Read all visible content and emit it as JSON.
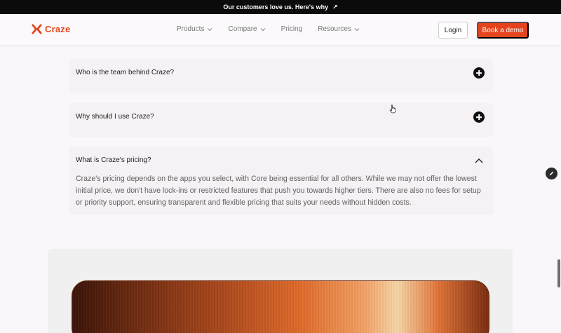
{
  "announcement": {
    "text": "Our customers love us. Here's why",
    "arrow": "↗"
  },
  "brand": {
    "name": "Craze",
    "color": "#e4441d",
    "icon": "craze-x-logo-icon"
  },
  "nav": {
    "items": [
      {
        "label": "Products",
        "has_dropdown": true
      },
      {
        "label": "Compare",
        "has_dropdown": true
      },
      {
        "label": "Pricing",
        "has_dropdown": false
      },
      {
        "label": "Resources",
        "has_dropdown": true
      }
    ],
    "login_label": "Login",
    "demo_label": "Book a demo"
  },
  "faq": [
    {
      "question": "Who is the team behind Craze?",
      "expanded": false,
      "icon": "plus-circle-icon"
    },
    {
      "question": "Why should I use Craze?",
      "expanded": false,
      "icon": "plus-circle-icon"
    },
    {
      "question": "What is Craze's pricing?",
      "expanded": true,
      "icon": "chevron-up-icon",
      "answer": "Craze's pricing depends on the apps you select, with Core being essential for all others. While we may not offer the lowest initial price, we don't have lock-ins or restricted features that push you towards higher tiers. There are also no fees for setup or priority support, ensuring transparent and flexible pricing that suits your needs without hidden costs."
    }
  ],
  "colors": {
    "accent": "#e4441d",
    "faq_bg": "#f6f1f4",
    "page_bg": "#f9f7f9"
  }
}
